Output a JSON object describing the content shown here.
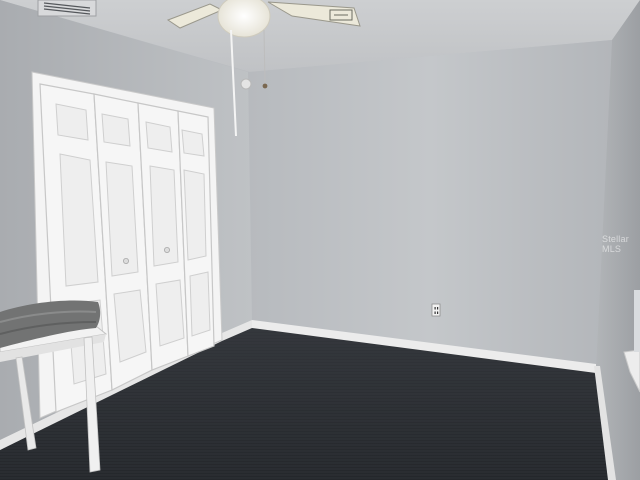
{
  "scene": {
    "description_free": true,
    "colors": {
      "ceiling": "#c7c9cc",
      "wall_back": "#bfc2c6",
      "wall_left": "#b5b8bc",
      "wall_right": "#a9acb0",
      "floor": "#2b2e33",
      "trim": "#eeeeee",
      "closet_door": "#f3f3f3",
      "fan": "#e9e6d6",
      "blanket": "#707070",
      "table": "#f1f1f1"
    }
  },
  "watermark": {
    "text": "Stellar MLS"
  }
}
